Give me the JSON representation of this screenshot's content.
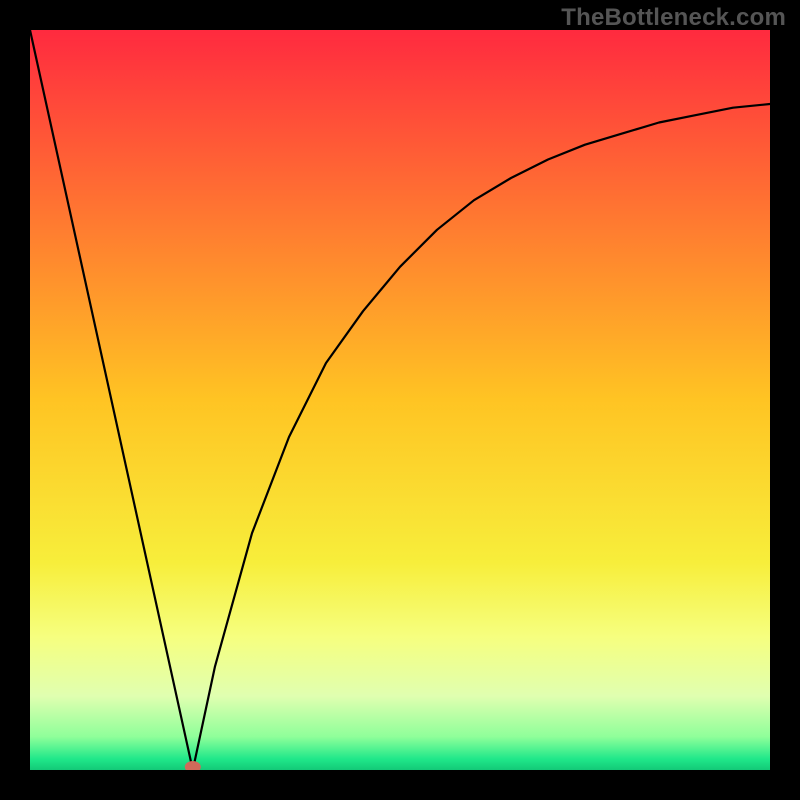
{
  "watermark": "TheBottleneck.com",
  "chart_data": {
    "type": "line",
    "title": "",
    "xlabel": "",
    "ylabel": "",
    "xlim": [
      0,
      100
    ],
    "ylim": [
      0,
      100
    ],
    "grid": false,
    "legend": false,
    "series": [
      {
        "name": "left-line",
        "x": [
          0,
          22
        ],
        "y": [
          100,
          0
        ]
      },
      {
        "name": "right-curve",
        "x": [
          22,
          25,
          30,
          35,
          40,
          45,
          50,
          55,
          60,
          65,
          70,
          75,
          80,
          85,
          90,
          95,
          100
        ],
        "y": [
          0,
          14,
          32,
          45,
          55,
          62,
          68,
          73,
          77,
          80,
          82.5,
          84.5,
          86,
          87.5,
          88.5,
          89.5,
          90
        ]
      }
    ],
    "marker": {
      "x": 22,
      "y": 0,
      "color": "#d06a5a"
    },
    "background_gradient": {
      "stops": [
        {
          "offset": 0.0,
          "color": "#ff2a3f"
        },
        {
          "offset": 0.5,
          "color": "#ffc423"
        },
        {
          "offset": 0.72,
          "color": "#f7ee3b"
        },
        {
          "offset": 0.82,
          "color": "#f6ff7f"
        },
        {
          "offset": 0.9,
          "color": "#e0ffb0"
        },
        {
          "offset": 0.955,
          "color": "#8fff9a"
        },
        {
          "offset": 0.985,
          "color": "#20e88a"
        },
        {
          "offset": 1.0,
          "color": "#13c977"
        }
      ]
    }
  }
}
